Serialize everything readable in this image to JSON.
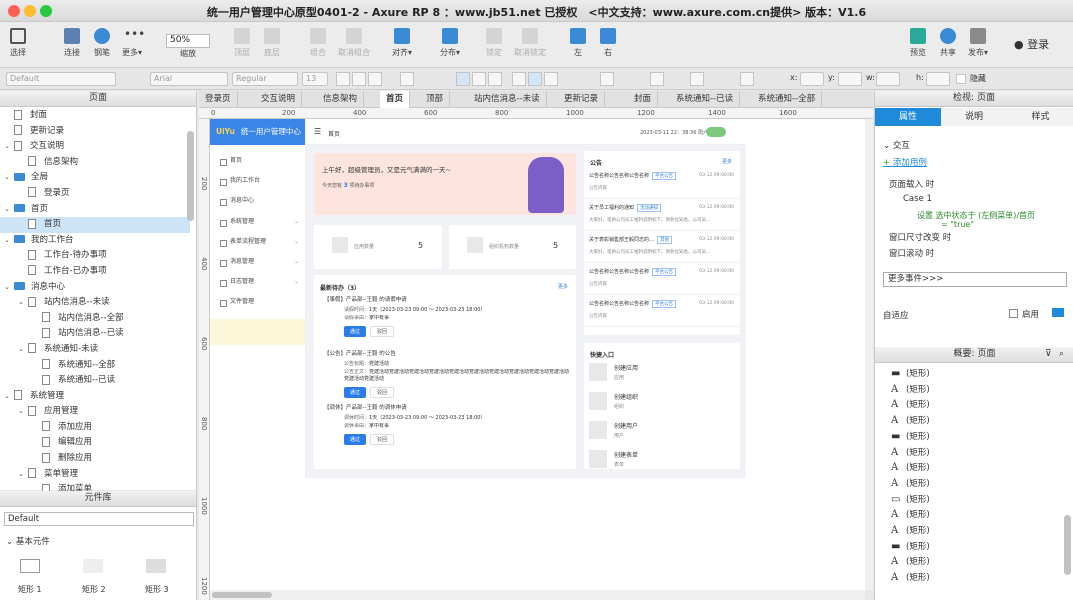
{
  "window": {
    "title": "统一用户管理中心原型0401-2 - Axure RP 8 ：www.jb51.net 已授权　<中文支持：www.axure.com.cn提供> 版本：V1.6"
  },
  "toolbar": {
    "select": "选择",
    "connect": "连接",
    "pen": "钢笔",
    "more": "更多▾",
    "zoom": "50%",
    "zoom_label": "缩放",
    "top": "顶层",
    "bottom": "底层",
    "group": "组合",
    "ungroup": "取消组合",
    "align": "对齐▾",
    "distribute": "分布▾",
    "lock": "锁定",
    "unlock": "取消锁定",
    "left": "左",
    "right": "右",
    "preview": "预览",
    "share": "共享",
    "publish": "发布▾",
    "login": "登录"
  },
  "format": {
    "style": "Default",
    "font": "Arial",
    "weight": "Regular",
    "size": "13",
    "x": "x:",
    "y": "y:",
    "w": "w:",
    "h": "h:",
    "hide": "隐藏"
  },
  "pages_panel": {
    "title": "页面",
    "items": [
      {
        "label": "封面",
        "depth": 0,
        "kind": "page"
      },
      {
        "label": "更新记录",
        "depth": 0,
        "kind": "page"
      },
      {
        "label": "交互说明",
        "depth": 0,
        "kind": "page",
        "arrow": "v"
      },
      {
        "label": "信息架构",
        "depth": 1,
        "kind": "page"
      },
      {
        "label": "全局",
        "depth": 0,
        "kind": "folder",
        "arrow": "v"
      },
      {
        "label": "登录页",
        "depth": 1,
        "kind": "page"
      },
      {
        "label": "首页",
        "depth": 0,
        "kind": "folder",
        "arrow": "v"
      },
      {
        "label": "首页",
        "depth": 1,
        "kind": "page",
        "selected": true
      },
      {
        "label": "我的工作台",
        "depth": 0,
        "kind": "folder",
        "arrow": "v"
      },
      {
        "label": "工作台-待办事项",
        "depth": 1,
        "kind": "page"
      },
      {
        "label": "工作台-已办事项",
        "depth": 1,
        "kind": "page"
      },
      {
        "label": "消息中心",
        "depth": 0,
        "kind": "folder",
        "arrow": "v"
      },
      {
        "label": "站内信消息--未读",
        "depth": 1,
        "kind": "page",
        "arrow": "v"
      },
      {
        "label": "站内信消息--全部",
        "depth": 2,
        "kind": "page"
      },
      {
        "label": "站内信消息--已读",
        "depth": 2,
        "kind": "page"
      },
      {
        "label": "系统通知-未读",
        "depth": 1,
        "kind": "page",
        "arrow": "v"
      },
      {
        "label": "系统通知--全部",
        "depth": 2,
        "kind": "page"
      },
      {
        "label": "系统通知--已读",
        "depth": 2,
        "kind": "page"
      },
      {
        "label": "系统管理",
        "depth": 0,
        "kind": "page",
        "arrow": "v"
      },
      {
        "label": "应用管理",
        "depth": 1,
        "kind": "page",
        "arrow": "v"
      },
      {
        "label": "添加应用",
        "depth": 2,
        "kind": "page"
      },
      {
        "label": "编辑应用",
        "depth": 2,
        "kind": "page"
      },
      {
        "label": "删除应用",
        "depth": 2,
        "kind": "page"
      },
      {
        "label": "菜单管理",
        "depth": 1,
        "kind": "page",
        "arrow": "v"
      },
      {
        "label": "添加菜单",
        "depth": 2,
        "kind": "page"
      }
    ]
  },
  "library": {
    "title": "元件库",
    "selected": "Default",
    "group": "基本元件",
    "items": [
      "矩形 1",
      "矩形 2",
      "矩形 3"
    ]
  },
  "tabs": [
    "登录页",
    "交互说明",
    "信息架构",
    "首页",
    "顶部",
    "站内信消息--未读",
    "更新记录",
    "封面",
    "系统通知--已读",
    "系统通知--全部"
  ],
  "ruler": {
    "h": [
      "0",
      "200",
      "400",
      "600",
      "800",
      "1000",
      "1200",
      "1400",
      "1600"
    ],
    "v": [
      "200",
      "400",
      "600",
      "800",
      "1000",
      "1200"
    ]
  },
  "app": {
    "logo": "UiYu",
    "name": "统一用户管理中心",
    "menu": [
      {
        "label": "首页"
      },
      {
        "label": "我的工作台"
      },
      {
        "label": "消息中心"
      },
      {
        "label": "系统管理",
        "chev": true
      },
      {
        "label": "表单流程管理",
        "chev": true
      },
      {
        "label": "消息管理",
        "chev": true
      },
      {
        "label": "日志管理",
        "chev": true
      },
      {
        "label": "文件管理"
      }
    ],
    "breadcrumb": "首页",
    "time": "2023-03-11 22：38:36  周六",
    "welcome": "上午好，超级管理员，又是元气满满的一天~",
    "todo_pre": "今天您有",
    "todo_num": "3",
    "todo_post": "项待办事项",
    "stats": [
      {
        "label": "应用数量",
        "value": "5"
      },
      {
        "label": "组织机构数量",
        "value": "5"
      }
    ],
    "todo_title": "最新待办（3）",
    "more": "更多",
    "todos": [
      {
        "title": "【事假】产品部--王毅 的请假申请",
        "l1": "请假时间：",
        "v1": "1天（2023-03-23  09:00 ～ 2023-03-23  18:00）",
        "l2": "请假事由：",
        "v2": "家中有事"
      },
      {
        "title": "【公告】产品部--王毅 的公告",
        "l1": "公告标题：",
        "v1": "党建活动",
        "l2": "公告正文：",
        "v2": "党建活动党建活动党建活动党建活动党建活动党建活动党建活动党建活动党建活动党建活动党建活动党建活动"
      },
      {
        "title": "【调休】产品部--王毅 的调休申请",
        "l1": "调休时间：",
        "v1": "1天（2023-03-23  09:00 ～ 2023-03-23  18:00）",
        "l2": "调休事由：",
        "v2": "家中有事"
      }
    ],
    "approve": "通过",
    "reject": "驳回",
    "notice_title": "公告",
    "notices": [
      {
        "t": "公告名称公告名称公告名称",
        "tag": "平台公告",
        "d": "03-12 09:00:00",
        "s": "公告内容"
      },
      {
        "t": "关于员工福利的通知",
        "tag": "活动通知",
        "d": "03-12 09:00:00",
        "s": "大家好，现将公司员工福利说明如下。请各位知悉。公司员..."
      },
      {
        "t": "关于表彰销售部王毅同志的…",
        "tag": "其他",
        "d": "03-12 09:00:00",
        "s": "大家好，现将公司员工福利说明如下。请各位知悉。公司员..."
      },
      {
        "t": "公告名称公告名称公告名称",
        "tag": "平台公告",
        "d": "03-12 09:00:00",
        "s": "公告内容"
      },
      {
        "t": "公告名称公告名称公告名称",
        "tag": "平台公告",
        "d": "03-12 09:00:00",
        "s": "公告内容"
      }
    ],
    "quick_title": "快捷入口",
    "quick": [
      {
        "t": "创建应用",
        "s": "应用"
      },
      {
        "t": "创建组织",
        "s": "组织"
      },
      {
        "t": "创建用户",
        "s": "用户"
      },
      {
        "t": "创建表单",
        "s": "表单"
      }
    ]
  },
  "inspector": {
    "title": "检视: 页面",
    "tabs": [
      "属性",
      "说明",
      "样式"
    ],
    "interaction": "交互",
    "add_case": "添加用例",
    "events": [
      {
        "label": "页面载入 时",
        "depth": 0
      },
      {
        "label": "Case 1",
        "depth": 1
      },
      {
        "label": "设置 选中状态于 (左侧菜单)/首页",
        "depth": 2
      },
      {
        "label": "= \"true\"",
        "depth": 2
      },
      {
        "label": "窗口尺寸改变 时",
        "depth": 0
      },
      {
        "label": "窗口滚动 时",
        "depth": 0
      }
    ],
    "more_events": "更多事件>>>",
    "adaptive": "自适应",
    "enable": "启用"
  },
  "outline": {
    "title": "概要: 页面",
    "items": [
      {
        "g": "line",
        "label": "(矩形)"
      },
      {
        "g": "A",
        "label": "(矩形)"
      },
      {
        "g": "A",
        "label": "(矩形)"
      },
      {
        "g": "A",
        "label": "(矩形)"
      },
      {
        "g": "line",
        "label": "(矩形)"
      },
      {
        "g": "A",
        "label": "(矩形)"
      },
      {
        "g": "A",
        "label": "(矩形)"
      },
      {
        "g": "A",
        "label": "(矩形)"
      },
      {
        "g": "rect",
        "label": "(矩形)"
      },
      {
        "g": "A",
        "label": "(矩形)"
      },
      {
        "g": "A",
        "label": "(矩形)"
      },
      {
        "g": "line",
        "label": "(矩形)"
      },
      {
        "g": "A",
        "label": "(矩形)"
      },
      {
        "g": "A",
        "label": "(矩形)"
      }
    ]
  }
}
